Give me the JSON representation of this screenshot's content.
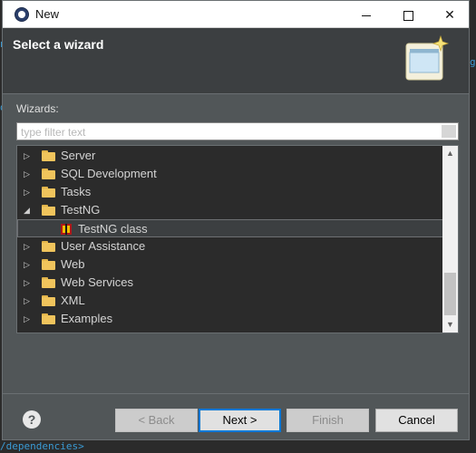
{
  "background": {
    "frag_a": "nj",
    "frag_b": "g",
    "frag_c": "d",
    "frag_d": "/dependencies>"
  },
  "window": {
    "title": "New"
  },
  "header": {
    "title": "Select a wizard"
  },
  "wizards": {
    "label": "Wizards:",
    "filter_placeholder": "type filter text",
    "filter_value": ""
  },
  "tree": {
    "items": [
      {
        "label": "Server",
        "expanded": false
      },
      {
        "label": "SQL Development",
        "expanded": false
      },
      {
        "label": "Tasks",
        "expanded": false
      },
      {
        "label": "TestNG",
        "expanded": true
      },
      {
        "label": "TestNG class",
        "child": true,
        "selected": true
      },
      {
        "label": "User Assistance",
        "expanded": false
      },
      {
        "label": "Web",
        "expanded": false
      },
      {
        "label": "Web Services",
        "expanded": false
      },
      {
        "label": "XML",
        "expanded": false
      },
      {
        "label": "Examples",
        "expanded": false
      }
    ]
  },
  "buttons": {
    "back": "< Back",
    "next": "Next >",
    "finish": "Finish",
    "cancel": "Cancel"
  },
  "colors": {
    "dialog_bg": "#515658",
    "tree_bg": "#2b2b2b",
    "accent": "#0078d7"
  }
}
